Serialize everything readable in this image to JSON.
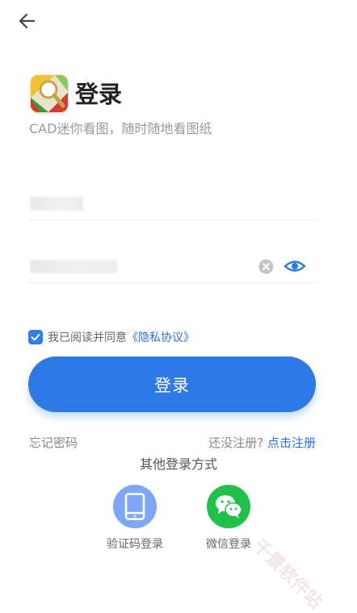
{
  "header": {
    "back_icon": "arrow-left-icon"
  },
  "app": {
    "logo_icon": "cad-magnifier-logo-icon",
    "title": "登录",
    "subtitle": "CAD迷你看图，随时随地看图纸"
  },
  "form": {
    "username_value": "",
    "password_value": "",
    "clear_icon": "clear-icon",
    "eye_icon": "eye-icon",
    "agree_text": "我已阅读并同意",
    "privacy_link": "《隐私协议》",
    "submit_label": "登录"
  },
  "links": {
    "forgot_password": "忘记密码",
    "no_account": "还没注册?",
    "register": "点击注册"
  },
  "other_login": {
    "title": "其他登录方式",
    "methods": [
      {
        "icon": "phone-icon",
        "label": "验证码登录"
      },
      {
        "icon": "wechat-icon",
        "label": "微信登录"
      }
    ]
  },
  "watermark": "千景软件站",
  "colors": {
    "primary": "#2d7ae7",
    "link": "#2f6fd6",
    "wechat": "#20c04a",
    "sms": "#7ea7f7"
  }
}
